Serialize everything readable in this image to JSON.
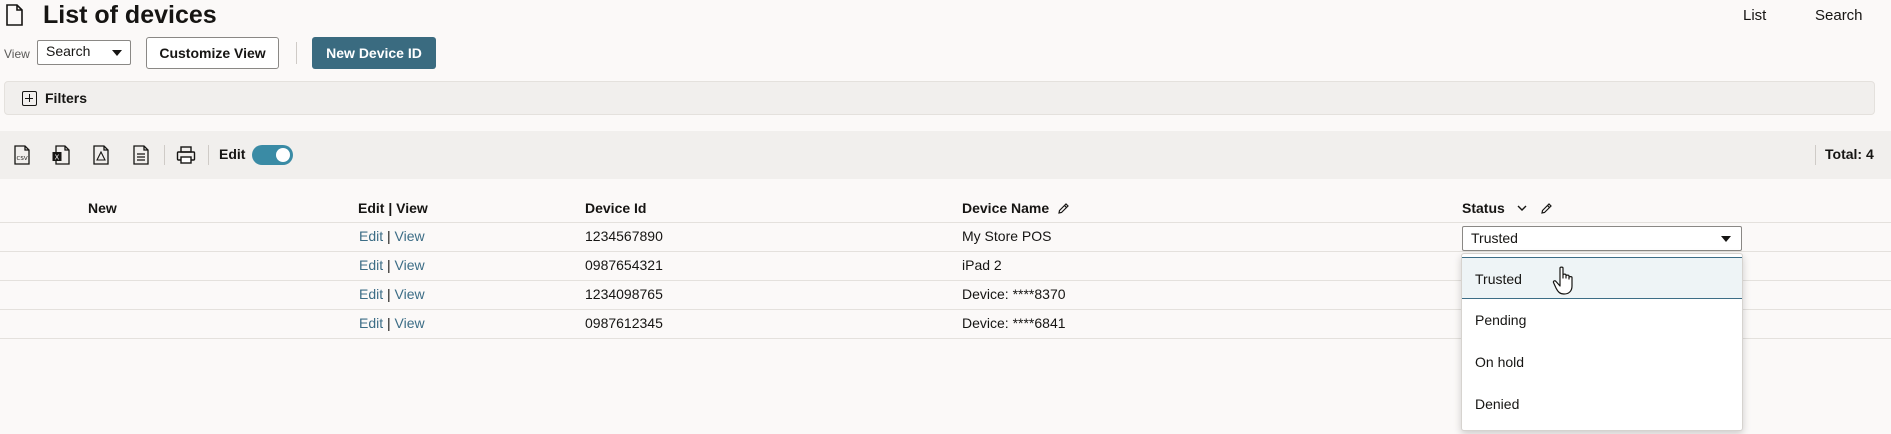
{
  "header": {
    "title": "List of devices",
    "links": [
      "List",
      "Search"
    ]
  },
  "controls": {
    "view_label": "View",
    "view_value": "Search",
    "customize_label": "Customize View",
    "new_device_label": "New Device ID"
  },
  "filters": {
    "label": "Filters"
  },
  "toolbar": {
    "icons": [
      "csv-export-icon",
      "excel-export-icon",
      "pdf-export-icon",
      "document-export-icon",
      "print-icon"
    ],
    "edit_label": "Edit",
    "edit_on": true,
    "total": "Total: 4"
  },
  "table": {
    "columns": [
      "New",
      "Edit | View",
      "Device Id",
      "Device Name",
      "Status"
    ],
    "edit_link": "Edit",
    "view_link": "View",
    "rows": [
      {
        "device_id": "1234567890",
        "device_name": "My Store POS",
        "status": "Trusted"
      },
      {
        "device_id": "0987654321",
        "device_name": "iPad 2"
      },
      {
        "device_id": "1234098765",
        "device_name": "Device: ****8370"
      },
      {
        "device_id": "0987612345",
        "device_name": "Device: ****6841"
      }
    ]
  },
  "status_dropdown": {
    "options": [
      "Trusted",
      "Pending",
      "On hold",
      "Denied"
    ],
    "highlighted": "Trusted"
  },
  "colors": {
    "primary": "#3a6b80",
    "link": "#3c6d86",
    "toggle": "#3a8ba5",
    "background": "#fbf9f8",
    "band": "#f1efed"
  }
}
